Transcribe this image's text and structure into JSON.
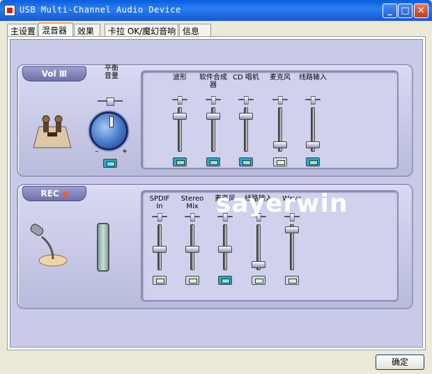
{
  "window": {
    "title": "USB Multi-Channel Audio Device"
  },
  "tabs": [
    {
      "label": "主设置"
    },
    {
      "label": "混音器"
    },
    {
      "label": "效果"
    },
    {
      "label": "卡拉 OK/魔幻音响"
    },
    {
      "label": "信息"
    }
  ],
  "playback": {
    "group_label": "Vol Ⅲ",
    "balance_label": "平衡\n音量",
    "knob_minus": "–",
    "knob_plus": "+",
    "channels": [
      {
        "label": "波形",
        "level": 0.85,
        "muted": true
      },
      {
        "label": "软件合成\n器",
        "level": 0.85,
        "muted": true
      },
      {
        "label": "CD 唱机",
        "level": 0.85,
        "muted": true
      },
      {
        "label": "麦克风",
        "level": 0.1,
        "muted": false
      },
      {
        "label": "线路输入",
        "level": 0.1,
        "muted": true
      }
    ]
  },
  "record": {
    "group_label": "REC",
    "channels": [
      {
        "label": "SPDIF\nIn",
        "level": 0.45,
        "muted": false
      },
      {
        "label": "Stereo\nMix",
        "level": 0.45,
        "muted": false
      },
      {
        "label": "麦克风",
        "level": 0.45,
        "muted": true
      },
      {
        "label": "线路输入",
        "level": 0.05,
        "muted": false
      },
      {
        "label": "Wave",
        "level": 0.95,
        "muted": false
      }
    ]
  },
  "watermark": "sayerwin",
  "ok_button": "确定"
}
